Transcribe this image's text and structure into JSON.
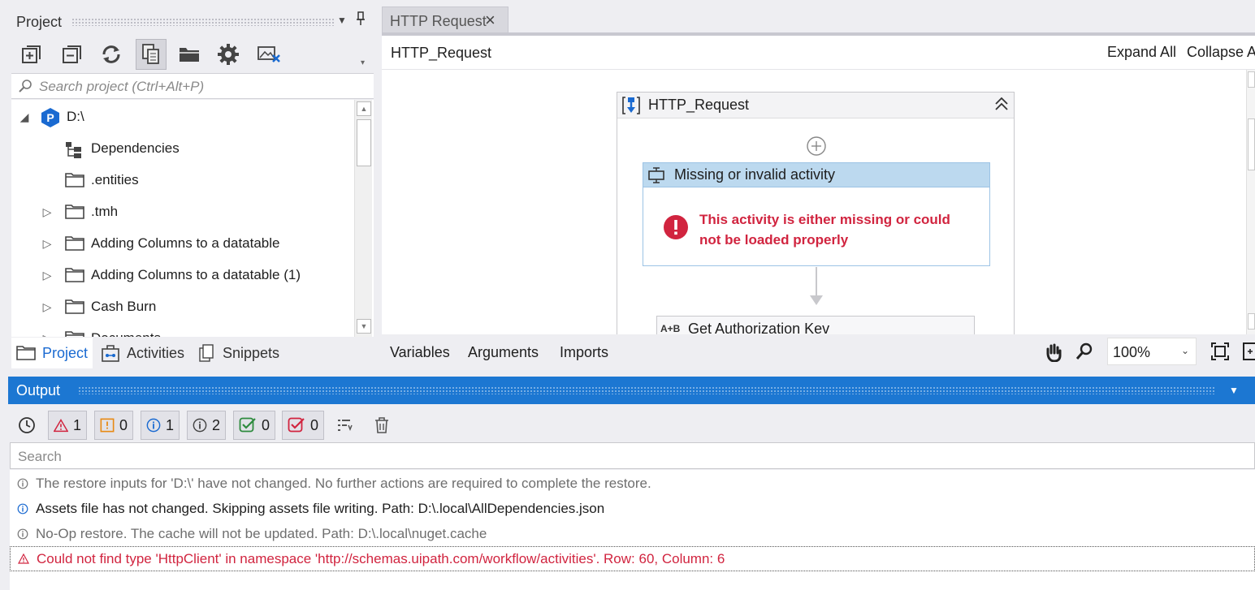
{
  "project_panel": {
    "title": "Project",
    "toolbar": [
      "expand-all-icon",
      "collapse-all-icon",
      "refresh-icon",
      "show-all-files-icon",
      "open-folder-icon",
      "settings-icon",
      "remove-unused-icon"
    ],
    "search_placeholder": "Search project (Ctrl+Alt+P)",
    "tree": [
      {
        "label": "D:\\",
        "expanded": true
      },
      {
        "label": "Dependencies"
      },
      {
        "label": ".entities"
      },
      {
        "label": ".tmh",
        "expander": true
      },
      {
        "label": "Adding Columns to a datatable",
        "expander": true
      },
      {
        "label": "Adding Columns to a datatable (1)",
        "expander": true
      },
      {
        "label": "Cash Burn",
        "expander": true
      },
      {
        "label": "Documents",
        "expander": true
      }
    ],
    "tabs": [
      "Project",
      "Activities",
      "Snippets"
    ]
  },
  "designer": {
    "tab_label": "HTTP Request",
    "breadcrumb": "HTTP_Request",
    "expand_all": "Expand All",
    "collapse_all": "Collapse A",
    "sequence_title": "HTTP_Request",
    "missing_title": "Missing or invalid activity",
    "missing_message": "This activity is either missing or could not be loaded properly",
    "next_activity": "Get Authorization Kev",
    "next_activity_prefix": "A+B",
    "footer": {
      "variables": "Variables",
      "arguments": "Arguments",
      "imports": "Imports",
      "zoom": "100%"
    }
  },
  "output": {
    "title": "Output",
    "filters": {
      "errors": "1",
      "warnings": "0",
      "info": "1",
      "trace": "2",
      "success": "0",
      "failed": "0"
    },
    "search_placeholder": "Search",
    "messages": [
      {
        "type": "trace",
        "text": "The restore inputs for 'D:\\' have not changed. No further actions are required to complete the restore."
      },
      {
        "type": "info",
        "text": "Assets file has not changed. Skipping assets file writing. Path: D:\\.local\\AllDependencies.json"
      },
      {
        "type": "trace",
        "text": "No-Op restore. The cache will not be updated. Path: D:\\.local\\nuget.cache"
      },
      {
        "type": "error",
        "text": "Could not find type 'HttpClient' in namespace 'http://schemas.uipath.com/workflow/activities'. Row: 60, Column: 6"
      }
    ]
  },
  "colors": {
    "accent": "#1c77d2",
    "error": "#d1243f",
    "missing_header": "#bcd9ef"
  }
}
